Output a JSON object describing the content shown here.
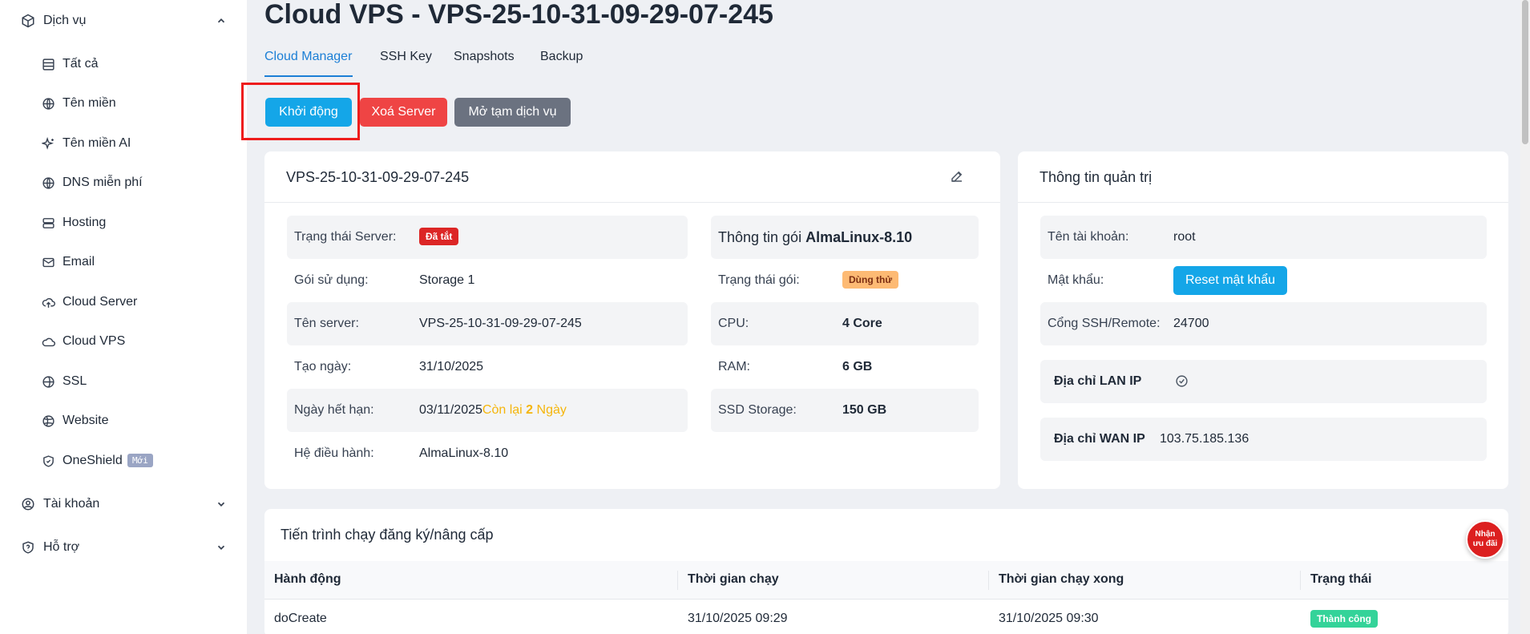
{
  "sidebar": {
    "services_group": "Dịch vụ",
    "items": [
      {
        "label": "Tất cả",
        "icon": "list-icon"
      },
      {
        "label": "Tên miền",
        "icon": "globe-icon"
      },
      {
        "label": "Tên miền AI",
        "icon": "sparkles-icon"
      },
      {
        "label": "DNS miễn phí",
        "icon": "globe-icon"
      },
      {
        "label": "Hosting",
        "icon": "server-icon"
      },
      {
        "label": "Email",
        "icon": "mail-icon"
      },
      {
        "label": "Cloud Server",
        "icon": "cloud-upload-icon"
      },
      {
        "label": "Cloud VPS",
        "icon": "cloud-icon"
      },
      {
        "label": "SSL",
        "icon": "globe-lock-icon"
      },
      {
        "label": "Website",
        "icon": "web-icon"
      },
      {
        "label": "OneShield",
        "icon": "shield-icon",
        "badge": "Mới"
      }
    ],
    "account_group": "Tài khoản",
    "support_group": "Hỗ trợ"
  },
  "page": {
    "title": "Cloud VPS - VPS-25-10-31-09-29-07-245"
  },
  "tabs": [
    "Cloud Manager",
    "SSH Key",
    "Snapshots",
    "Backup"
  ],
  "actions": {
    "start": "Khởi động",
    "delete": "Xoá Server",
    "unsuspend": "Mở tạm dịch vụ"
  },
  "server_card": {
    "title": "VPS-25-10-31-09-29-07-245",
    "status_label": "Trạng thái Server:",
    "status_value": "Đã tắt",
    "plan_label": "Gói sử dụng:",
    "plan_value": "Storage 1",
    "name_label": "Tên server:",
    "name_value": "VPS-25-10-31-09-29-07-245",
    "created_label": "Tạo ngày:",
    "created_value": "31/10/2025",
    "expire_label": "Ngày hết hạn:",
    "expire_value": "03/11/2025",
    "remaining_prefix": "Còn lại",
    "remaining_days": "2",
    "remaining_suffix": "Ngày",
    "os_label": "Hệ điều hành:",
    "os_value": "AlmaLinux-8.10",
    "package_heading_prefix": "Thông tin gói",
    "package_heading_name": "AlmaLinux-8.10",
    "pkg_status_label": "Trạng thái gói:",
    "pkg_status_value": "Dùng thử",
    "cpu_label": "CPU:",
    "cpu_value": "4 Core",
    "ram_label": "RAM:",
    "ram_value": "6 GB",
    "ssd_label": "SSD Storage:",
    "ssd_value": "150 GB"
  },
  "admin_card": {
    "title": "Thông tin quản trị",
    "account_label": "Tên tài khoản:",
    "account_value": "root",
    "password_label": "Mật khẩu:",
    "reset_button": "Reset mật khẩu",
    "port_label": "Cổng SSH/Remote:",
    "port_value": "24700",
    "lan_label": "Địa chỉ LAN IP",
    "wan_label": "Địa chỉ WAN IP",
    "wan_value": "103.75.185.136"
  },
  "process_table": {
    "title": "Tiến trình chạy đăng ký/nâng cấp",
    "columns": [
      "Hành động",
      "Thời gian chạy",
      "Thời gian chạy xong",
      "Trạng thái"
    ],
    "rows": [
      {
        "action": "doCreate",
        "start": "31/10/2025 09:29",
        "end": "31/10/2025 09:30",
        "status": "Thành công"
      }
    ]
  },
  "promo": {
    "line1": "Nhận",
    "line2": "ưu đãi"
  },
  "colors": {
    "accent": "#1c7fd6",
    "primary_button": "#14a6e8",
    "danger": "#ef4444",
    "highlight": "#ee1c1c"
  }
}
